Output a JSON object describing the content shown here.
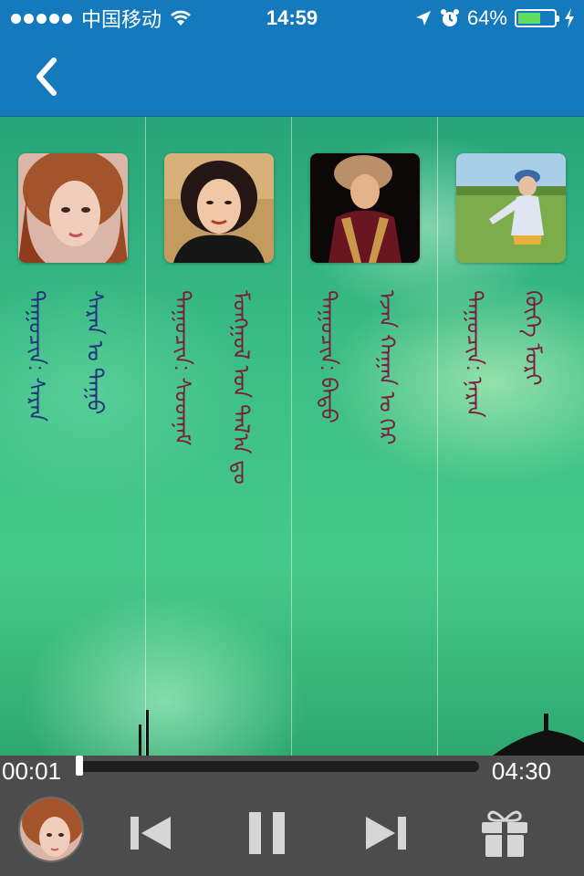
{
  "status_bar": {
    "carrier": "中国移动",
    "time": "14:59",
    "battery": "64%",
    "battery_level": 0.64,
    "icons": [
      "signal-dots",
      "wifi-icon",
      "location-arrow-icon",
      "alarm-icon",
      "battery-icon",
      "charging-icon"
    ]
  },
  "nav": {
    "back_icon": "chevron-left-icon",
    "color": "#1479bd"
  },
  "songs": [
    {
      "artist_line": "ᠳᠠᠭᠤᠴᠢᠨ: ᠰᠠᠷᠠᠨ",
      "title_line": "ᠰᠠᠷᠠᠨ ᠤ ᠳᠠᠭᠤ"
    },
    {
      "artist_line": "ᠳᠠᠭᠤᠴᠢᠨ: ᠰᠣᠳᠨᠠᠮ",
      "title_line": "ᠮᠣᠩᠭᠣᠯ ᠤᠨ ᠲᠠᠯ᠎ᠠ ᠳᠤ"
    },
    {
      "artist_line": "ᠳᠠᠭᠤᠴᠢᠨ: ᠪᠠᠲᠤ",
      "title_line": "ᠡᠵᠡᠨ ᠬᠠᠭᠠᠨ ᠤ ᠭᠡᠷ"
    },
    {
      "artist_line": "ᠳᠠᠭᠤᠴᠢᠨ: ᠨᠠᠷᠠᠨ",
      "title_line": "ᠬᠦᠬᠡ ᠮᠣᠷᠢ"
    }
  ],
  "player": {
    "elapsed": "00:01",
    "total": "04:30",
    "progress": 0.004,
    "controls": [
      "previous-icon",
      "pause-icon",
      "next-icon",
      "gift-icon"
    ]
  }
}
